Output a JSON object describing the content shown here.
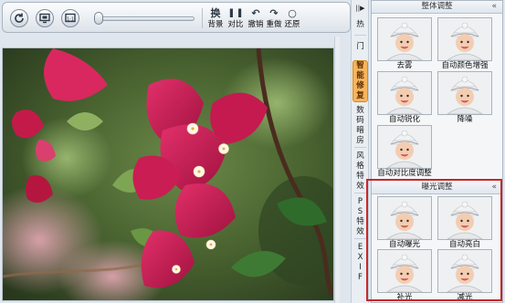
{
  "toolbar": {
    "icons": [
      "refresh-icon",
      "fit-screen-icon",
      "actual-size-icon"
    ],
    "buttons": [
      {
        "id": "swap-background",
        "glyph": "换",
        "label": "背景"
      },
      {
        "id": "compare",
        "glyph": "▌▐",
        "label": "对比"
      },
      {
        "id": "undo",
        "glyph": "↶",
        "label": "撤销"
      },
      {
        "id": "redo",
        "glyph": "↷",
        "label": "重做"
      },
      {
        "id": "restore",
        "glyph": "○",
        "label": "还原"
      }
    ]
  },
  "side_tabs": {
    "collapse_glyph": "||▶",
    "items": [
      {
        "chars": [
          "热"
        ]
      },
      {
        "chars": [
          "门"
        ]
      },
      {
        "chars": [
          "智",
          "能",
          "修",
          "复"
        ],
        "active": true
      },
      {
        "chars": [
          "数",
          "码",
          "暗",
          "房"
        ]
      },
      {
        "chars": [
          "风",
          "格",
          "特",
          "效"
        ]
      },
      {
        "chars": [
          "P",
          "S",
          "特",
          "效"
        ]
      },
      {
        "chars": [
          "E",
          "X",
          "I",
          "F"
        ]
      }
    ]
  },
  "panel": {
    "sections": [
      {
        "title": "整体调整",
        "collapse": "«",
        "items": [
          "去雾",
          "自动颜色增强",
          "自动锐化",
          "降噪",
          "自动对比度调整"
        ]
      },
      {
        "title": "曝光调整",
        "collapse": "«",
        "items": [
          "自动曝光",
          "自动亮白",
          "补光",
          "减光"
        ]
      }
    ]
  },
  "colors": {
    "accent_tab": "#f7b55b",
    "highlight_border": "#c9262a",
    "panel_bg": "#f4f6f8"
  }
}
